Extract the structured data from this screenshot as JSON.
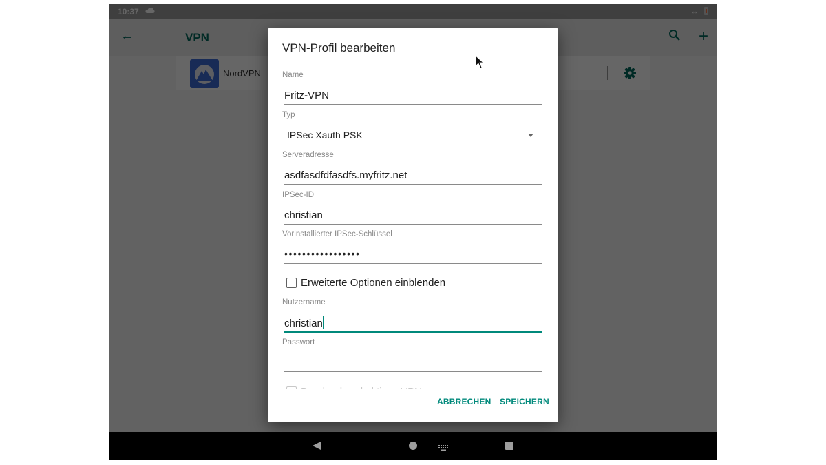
{
  "statusbar": {
    "time": "10:37",
    "icons": [
      "cloud-icon",
      "screen-rotate-icon",
      "battery-low-icon"
    ],
    "rotate_glyph": "↔"
  },
  "appbar": {
    "back_glyph": "←",
    "title": "VPN",
    "add_glyph": "+"
  },
  "vpn_list": [
    {
      "name": "NordVPN"
    }
  ],
  "dialog": {
    "title": "VPN-Profil bearbeiten",
    "fields": {
      "name": {
        "label": "Name",
        "value": "Fritz-VPN"
      },
      "type": {
        "label": "Typ",
        "value": "IPSec Xauth PSK"
      },
      "server": {
        "label": "Serveradresse",
        "value": "asdfasdfdfasdfs.myfritz.net"
      },
      "ipsec_id": {
        "label": "IPSec-ID",
        "value": "christian"
      },
      "psk": {
        "label": "Vorinstallierter IPSec-Schlüssel",
        "value": "•••••••••••••••••"
      },
      "username": {
        "label": "Nutzername",
        "value": "christian"
      },
      "password": {
        "label": "Passwort",
        "value": ""
      }
    },
    "advanced_checkbox": {
      "label": "Erweiterte Optionen einblenden",
      "checked": false
    },
    "always_on_checkbox": {
      "label": "Durchgehend aktives VPN",
      "checked": false
    },
    "cancel_label": "ABBRECHEN",
    "save_label": "SPEICHERN"
  },
  "colors": {
    "accent": "#00897b",
    "appbar_accent": "#00695c",
    "nordvpn_blue": "#3e6bd8"
  }
}
